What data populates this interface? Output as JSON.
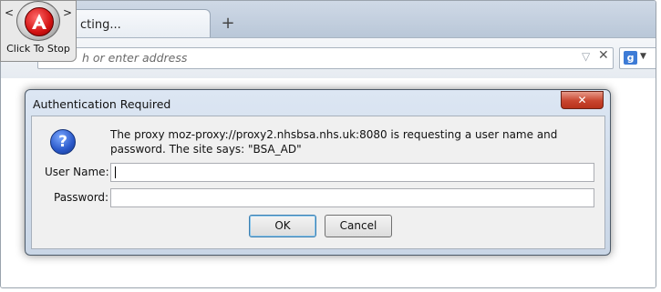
{
  "browser": {
    "tab_title": "cting...",
    "new_tab_symbol": "+",
    "address_placeholder": "h or enter address",
    "address_dropdown_symbol": "▽",
    "address_clear_symbol": "✕",
    "search_engine_icon": "g"
  },
  "stop_widget": {
    "label": "Click To Stop",
    "left_arrow": "<",
    "right_arrow": ">"
  },
  "dialog": {
    "title": "Authentication Required",
    "close_symbol": "✕",
    "message": "The proxy moz-proxy://proxy2.nhsbsa.nhs.uk:8080 is requesting a user name and password. The site says: \"BSA_AD\"",
    "username_label": "User Name:",
    "password_label": "Password:",
    "username_value": "",
    "password_value": "",
    "ok_label": "OK",
    "cancel_label": "Cancel",
    "icon": "question-icon"
  }
}
